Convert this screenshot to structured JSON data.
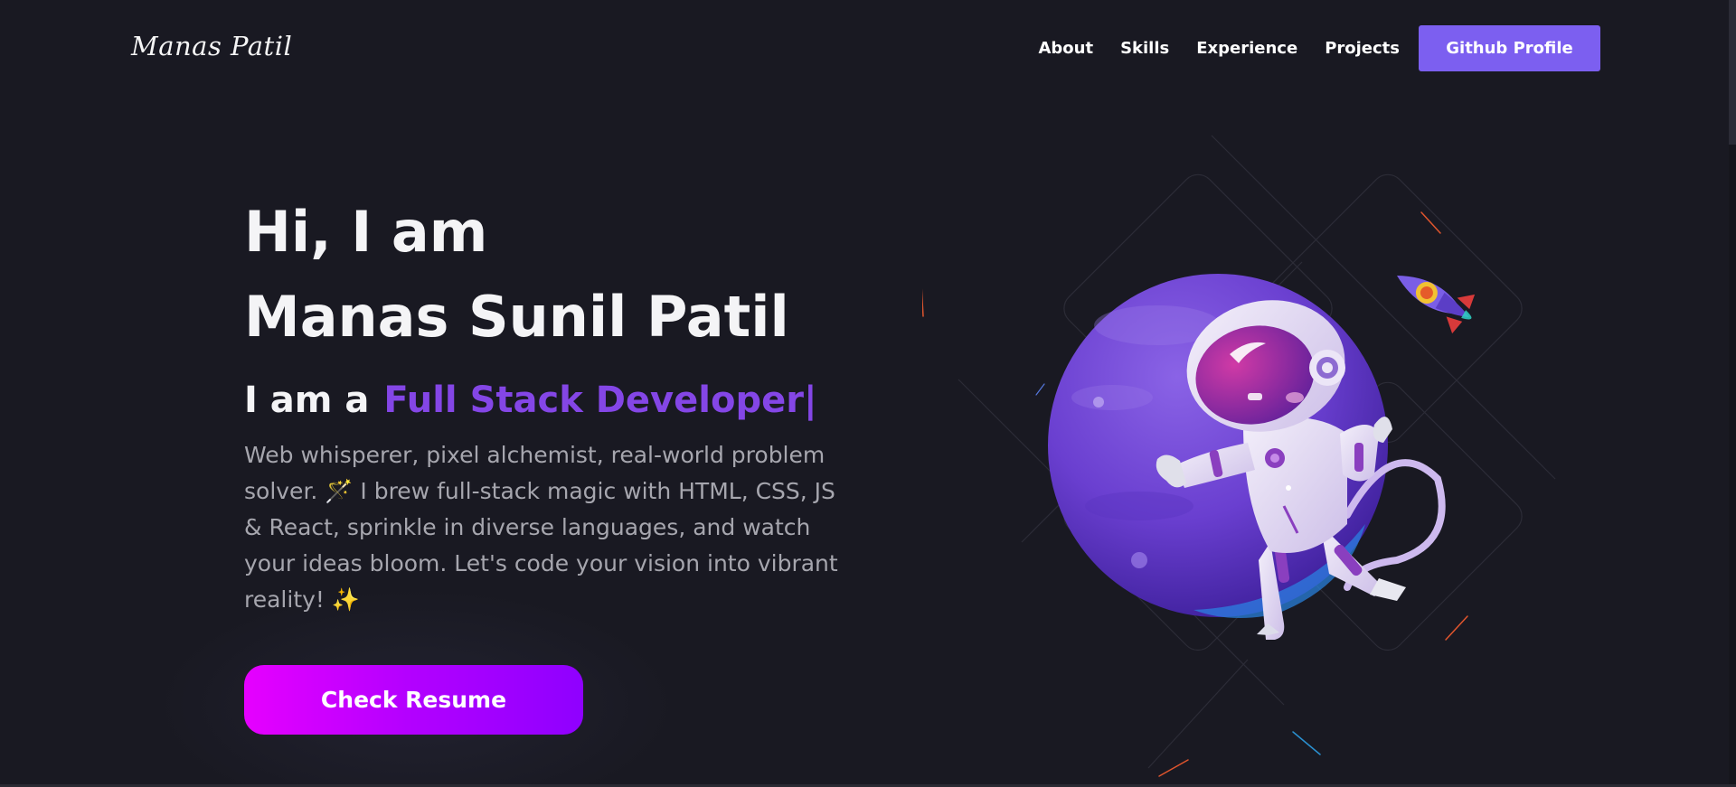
{
  "header": {
    "logo": "Manas Patil",
    "nav": [
      "About",
      "Skills",
      "Experience",
      "Projects"
    ],
    "github_button": "Github Profile"
  },
  "hero": {
    "line1": "Hi, I am",
    "line2": "Manas Sunil Patil",
    "role_prefix": "I am a",
    "role_word": "Full Stack Developer|",
    "description": "Web whisperer, pixel alchemist, real-world problem solver. 🪄 I brew full-stack magic with HTML, CSS, JS & React, sprinkle in diverse languages, and watch your ideas bloom. Let's code your vision into vibrant reality! ✨",
    "resume_button": "Check Resume"
  },
  "colors": {
    "background": "#191922",
    "accent": "#7c5ff0",
    "role_word": "#8446e6",
    "resume_gradient_start": "#e600ff",
    "resume_gradient_end": "#8f00ff"
  },
  "illustration": {
    "subject": "astronaut-on-planet",
    "extras": [
      "rocket",
      "shooting-stars",
      "diamond-grid"
    ]
  }
}
